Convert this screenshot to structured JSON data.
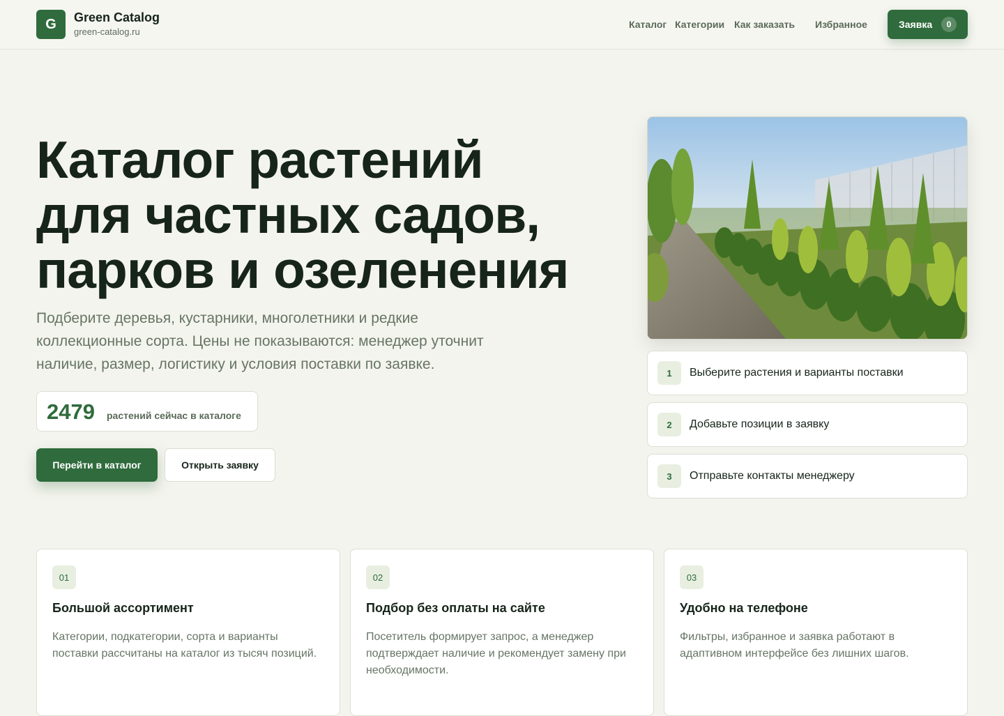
{
  "brand": {
    "logo_letter": "G",
    "name": "Green Catalog",
    "domain": "green-catalog.ru"
  },
  "nav": {
    "catalog": "Каталог",
    "categories": "Категории",
    "how_to_order": "Как заказать",
    "favorites": "Избранное"
  },
  "order_button": {
    "label": "Заявка",
    "count": "0"
  },
  "hero": {
    "title_line1": "Каталог растений",
    "title_line2": "для частных садов,",
    "title_line3": "парков и озеленения",
    "subtitle": "Подберите деревья, кустарники, многолетники и редкие коллекционные сорта. Цены не показываются: менеджер уточнит наличие, размер, логистику и условия поставки по заявке.",
    "stat_value": "2479",
    "stat_label": "растений сейчас в каталоге",
    "primary_button": "Перейти в каталог",
    "secondary_button": "Открыть заявку"
  },
  "steps": [
    {
      "num": "1",
      "text": "Выберите растения и варианты поставки"
    },
    {
      "num": "2",
      "text": "Добавьте позиции в заявку"
    },
    {
      "num": "3",
      "text": "Отправьте контакты менеджеру"
    }
  ],
  "features": [
    {
      "badge": "01",
      "title": "Большой ассортимент",
      "text": "Категории, подкатегории, сорта и варианты поставки рассчитаны на каталог из тысяч позиций."
    },
    {
      "badge": "02",
      "title": "Подбор без оплаты на сайте",
      "text": "Посетитель формирует запрос, а менеджер подтверждает наличие и рекомендует замену при необходимости."
    },
    {
      "badge": "03",
      "title": "Удобно на телефоне",
      "text": "Фильтры, избранное и заявка работают в адаптивном интерфейсе без лишних шагов."
    }
  ],
  "colors": {
    "accent": "#2f6b3c",
    "background": "#f4f4ee",
    "muted_text": "#667565",
    "badge_bg": "#e8efe1"
  }
}
